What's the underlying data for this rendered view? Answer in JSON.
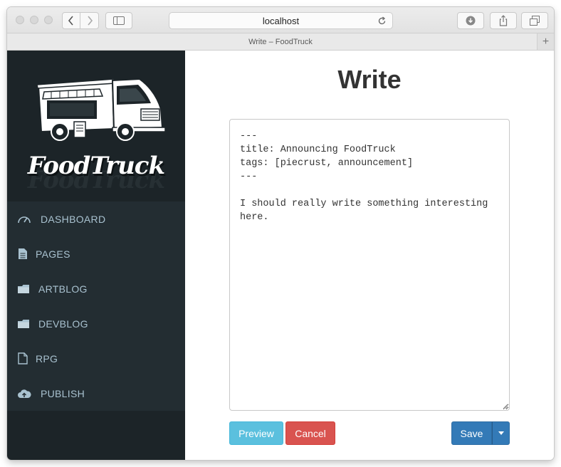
{
  "browser": {
    "url": "localhost",
    "tab_title": "Write – FoodTruck",
    "new_tab_label": "+"
  },
  "sidebar": {
    "brand": "FoodTruck",
    "items": [
      {
        "label": "DASHBOARD",
        "icon": "dashboard-gauge-icon"
      },
      {
        "label": "PAGES",
        "icon": "file-text-icon"
      },
      {
        "label": "ARTBLOG",
        "icon": "folder-icon"
      },
      {
        "label": "DEVBLOG",
        "icon": "folder-icon"
      },
      {
        "label": "RPG",
        "icon": "file-outline-icon"
      },
      {
        "label": "PUBLISH",
        "icon": "cloud-upload-icon"
      }
    ]
  },
  "main": {
    "title": "Write",
    "editor_content": "---\ntitle: Announcing FoodTruck\ntags: [piecrust, announcement]\n---\n\nI should really write something interesting here.",
    "buttons": {
      "preview": "Preview",
      "cancel": "Cancel",
      "save": "Save"
    }
  },
  "colors": {
    "sidebar_bg": "#1c2428",
    "nav_bg": "#232d32",
    "nav_text": "#a9c2d0",
    "preview": "#5bc0de",
    "cancel": "#d9534f",
    "save": "#337ab7"
  }
}
